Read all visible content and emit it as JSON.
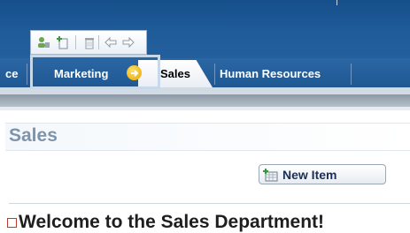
{
  "colors": {
    "header": "#1f5c99",
    "tab_text": "#ffffff",
    "active_tab_text": "#000000",
    "title_text": "#7d94ab",
    "button_text": "#1c2f52"
  },
  "toolbar": {
    "icons": [
      "user-icon",
      "add-document-icon",
      "trash-icon",
      "left-arrow-icon",
      "right-arrow-icon"
    ]
  },
  "tabs": {
    "prev": "ce",
    "marketing": "Marketing",
    "sales": "Sales",
    "hr": "Human Resources"
  },
  "page": {
    "title": "Sales",
    "new_item": "New Item",
    "welcome": "Welcome to the Sales Department!"
  }
}
